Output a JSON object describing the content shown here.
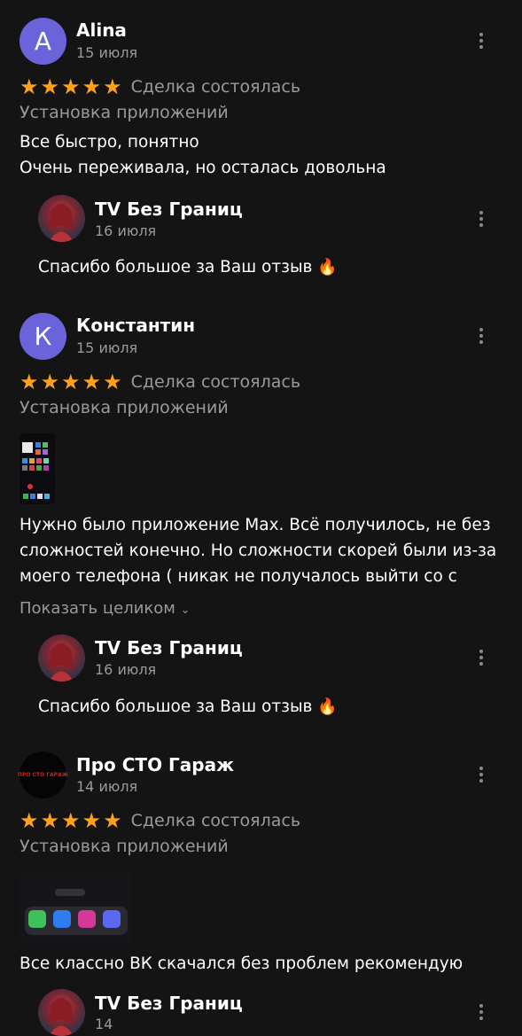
{
  "reviews": [
    {
      "avatar_letter": "A",
      "author": "Alina",
      "date": "15 июля",
      "deal_status": "Сделка состоялась",
      "service": "Установка приложений",
      "text_lines": [
        "Все быстро, понятно",
        "Очень переживала, но осталась довольна"
      ],
      "reply": {
        "author": "TV Без Границ",
        "date": "16 июля",
        "text": "Спасибо большое за Ваш отзыв"
      }
    },
    {
      "avatar_letter": "К",
      "author": "Константин",
      "date": "15 июля",
      "deal_status": "Сделка состоялась",
      "service": "Установка приложений",
      "text_lines": [
        "Нужно было приложение Max. Всё получилось, не без",
        "сложностей конечно. Но сложности скорей были из-за",
        "моего телефона ( никак не получалось выйти со с"
      ],
      "show_more": "Показать целиком",
      "reply": {
        "author": "TV Без Границ",
        "date": "16 июля",
        "text": "Спасибо большое за Ваш отзыв"
      }
    },
    {
      "avatar_text": "ПРО СТО ГАРАЖ",
      "author": "Про СТО Гараж",
      "date": "14 июля",
      "deal_status": "Сделка состоялась",
      "service": "Установка приложений",
      "text_lines": [
        "Все классно ВК скачался без проблем рекомендую"
      ],
      "reply": {
        "author": "TV Без Границ",
        "date": "14"
      }
    }
  ],
  "icons": {
    "star": "star-icon",
    "more": "more-vertical-icon",
    "fire": "fire-icon"
  },
  "colors": {
    "accent_star": "#ffa21a",
    "avatar_bg": "#6b63d9",
    "background": "#141414"
  }
}
